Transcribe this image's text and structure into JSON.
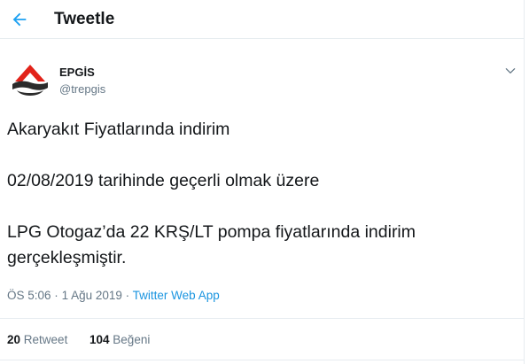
{
  "header": {
    "back_icon": "arrow-left-icon",
    "title": "Tweetle"
  },
  "tweet": {
    "author_name": "EPGİS",
    "author_handle": "@trepgis",
    "avatar_icon": "epgis-logo",
    "menu_icon": "chevron-down-icon",
    "lines": [
      "Akaryakıt Fiyatlarında indirim",
      "02/08/2019 tarihinde geçerli olmak üzere",
      "LPG Otogaz’da 22 KRŞ/LT pompa fiyatlarında indirim gerçekleşmiştir."
    ],
    "time": "ÖS 5:06",
    "separator": "·",
    "date": "1 Ağu 2019",
    "source": "Twitter Web App"
  },
  "stats": {
    "retweet_count": "20",
    "retweet_label": "Retweet",
    "like_count": "104",
    "like_label": "Beğeni"
  },
  "colors": {
    "accent": "#1da1f2",
    "link": "#1b95e0",
    "muted": "#657786",
    "logo_red": "#e2231a",
    "logo_dark": "#2b2b2b"
  }
}
